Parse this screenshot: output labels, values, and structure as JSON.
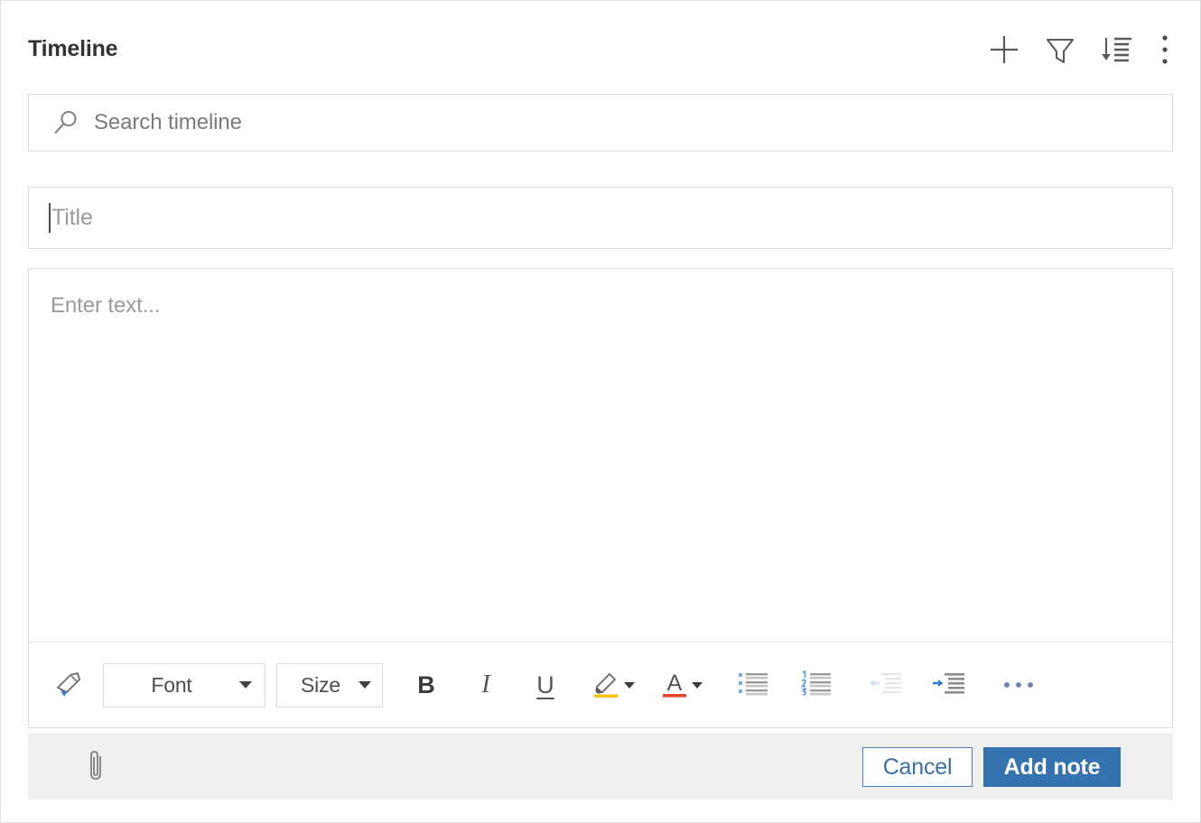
{
  "header": {
    "title": "Timeline",
    "actions": [
      {
        "name": "add-icon",
        "label": "Add"
      },
      {
        "name": "filter-icon",
        "label": "Filter"
      },
      {
        "name": "sort-icon",
        "label": "Sort"
      },
      {
        "name": "more-options-icon",
        "label": "More options"
      }
    ]
  },
  "search": {
    "placeholder": "Search timeline",
    "value": "",
    "icon": "search-icon"
  },
  "note_form": {
    "title_field": {
      "placeholder": "Title",
      "value": "",
      "caret_visible": true
    },
    "body_field": {
      "placeholder": "Enter text...",
      "value": ""
    },
    "toolbar": {
      "format_painter": "format-painter-icon",
      "font": {
        "label": "Font",
        "value": ""
      },
      "size": {
        "label": "Size",
        "value": ""
      },
      "bold": "B",
      "italic": "I",
      "underline": "U",
      "highlight": "highlight-icon",
      "font_color": "font-color-icon",
      "bulleted_list": "bulleted-list-icon",
      "numbered_list": "numbered-list-icon",
      "decrease_indent": "decrease-indent-icon",
      "increase_indent": "increase-indent-icon",
      "overflow": "more-formatting-icon"
    },
    "footer": {
      "attach": "attachment-icon",
      "cancel_label": "Cancel",
      "submit_label": "Add note"
    }
  },
  "colors": {
    "accent_blue": "#3573b0",
    "cancel_border": "#4a7fbc",
    "footer_bg": "#efefef",
    "border": "#dcdcdc",
    "placeholder_text": "#9b9b9b",
    "highlight_yellow": "#ffc000",
    "font_color_red": "#e8452c"
  }
}
